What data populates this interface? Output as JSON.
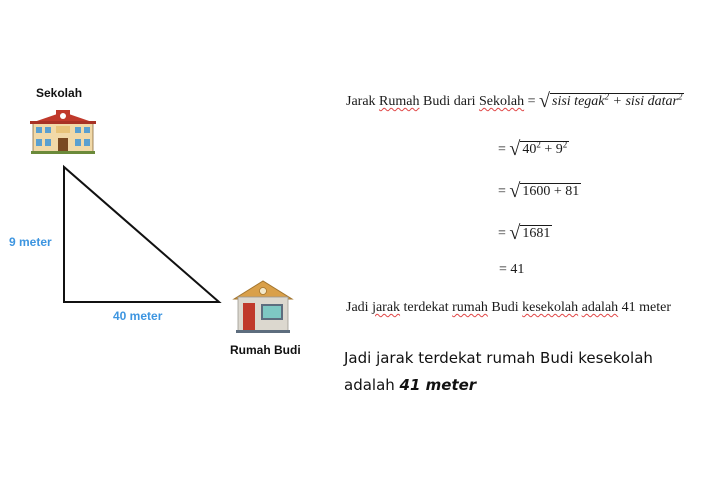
{
  "diagram": {
    "school_label": "Sekolah",
    "home_label": "Rumah Budi",
    "vertical_side": "9 meter",
    "horizontal_side": "40 meter",
    "accent_color": "#3d95e0",
    "icons": [
      "school-building-icon",
      "house-icon"
    ]
  },
  "formula": {
    "line1_prefix": "Jarak ",
    "line1_w_rumah": "Rumah",
    "line1_budi": " Budi ",
    "line1_dari": "dari",
    "line1_w_sekolah": "Sekolah",
    "line1_eq": " = ",
    "line1_rad_a": "sisi tegak",
    "line1_rad_plus": " + ",
    "line1_rad_b": "sisi datar",
    "exp2": "2",
    "line2_eq": "= ",
    "line2_rad": "40",
    "line2_plus": " + 9",
    "line3": "= ",
    "line3_rad": "1600 + 81",
    "line4": "= ",
    "line4_rad": "1681",
    "line5": "= 41",
    "conclusion_a": "Jadi ",
    "conclusion_w1": "jarak",
    "conclusion_b": " terdekat ",
    "conclusion_w2": "rumah",
    "conclusion_c": " Budi ",
    "conclusion_w3": "kesekolah",
    "conclusion_d": " ",
    "conclusion_w4": "adalah",
    "conclusion_e": " 41 meter"
  },
  "summary": {
    "text": "Jadi jarak terdekat rumah Budi kesekolah adalah ",
    "answer": "41 meter"
  }
}
